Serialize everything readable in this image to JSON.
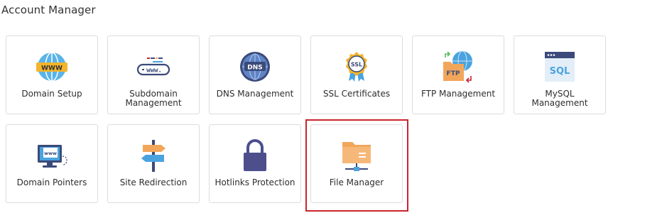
{
  "section": {
    "title": "Account Manager"
  },
  "tiles": [
    {
      "label": "Domain Setup",
      "icon": "www-globe-icon"
    },
    {
      "label": "Subdomain Management",
      "icon": "subdomain-url-icon"
    },
    {
      "label": "DNS Management",
      "icon": "dns-globe-icon"
    },
    {
      "label": "SSL Certificates",
      "icon": "ssl-badge-icon"
    },
    {
      "label": "FTP Management",
      "icon": "ftp-folder-icon"
    },
    {
      "label": "MySQL Management",
      "icon": "sql-window-icon"
    },
    {
      "label": "Domain Pointers",
      "icon": "monitor-www-icon"
    },
    {
      "label": "Site Redirection",
      "icon": "signpost-icon"
    },
    {
      "label": "Hotlinks Protection",
      "icon": "padlock-icon"
    },
    {
      "label": "File Manager",
      "icon": "folder-network-icon"
    }
  ],
  "icon_text": {
    "www": "WWW",
    "www_url": "www.",
    "dns": "DNS",
    "ssl": "SSL",
    "ftp": "FTP",
    "sql": "SQL",
    "monitor_www": "www"
  },
  "colors": {
    "highlight": "#c9252c",
    "tile_border": "#dcdcdc",
    "folder_orange": "#f2a65a",
    "globe_blue": "#4aa3df",
    "dns_navy": "#3b4a7a",
    "lock_navy": "#4c4f8c"
  }
}
